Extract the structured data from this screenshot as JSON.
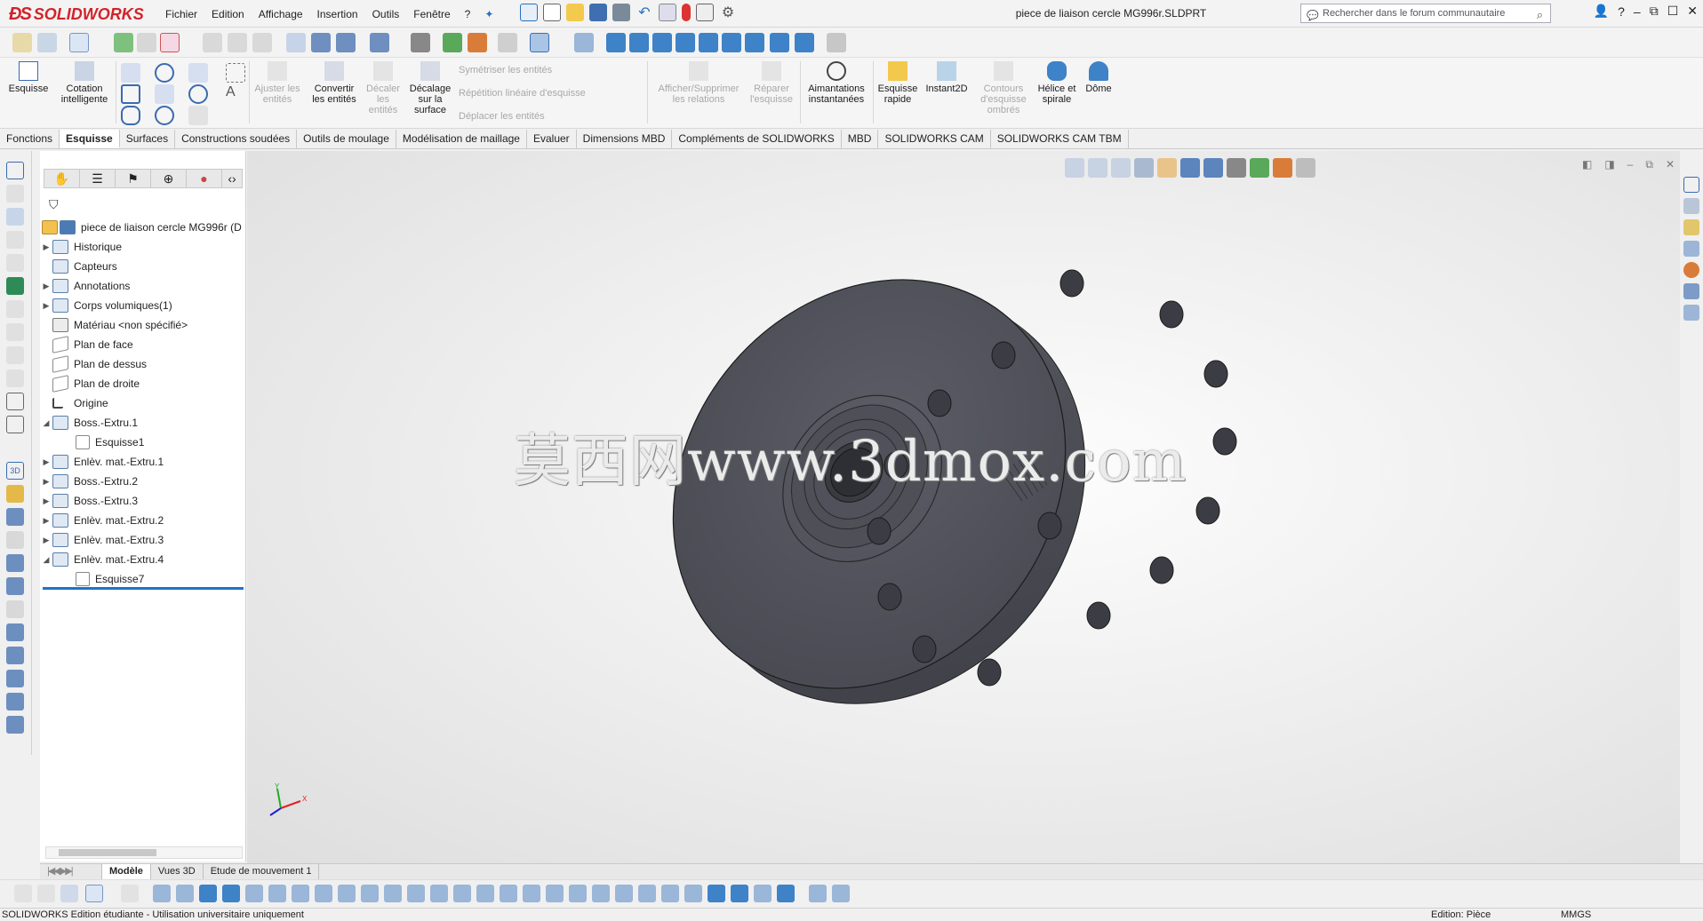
{
  "app": {
    "name": "SOLIDWORKS",
    "title": "piece de liaison cercle MG996r.SLDPRT"
  },
  "menu": [
    "Fichier",
    "Edition",
    "Affichage",
    "Insertion",
    "Outils",
    "Fenêtre",
    "?"
  ],
  "search": {
    "placeholder": "Rechercher dans le forum communautaire"
  },
  "ribbon": {
    "esquisse": "Esquisse",
    "cotation": "Cotation intelligente",
    "ajuster": "Ajuster les entités",
    "convertir": "Convertir les entités",
    "decaler": "Décaler les entités",
    "decalage_surface": "Décalage sur la surface",
    "symetriser": "Symétriser les entités",
    "repetition": "Répétition linéaire d'esquisse",
    "deplacer": "Déplacer les entités",
    "afficher_relations": "Afficher/Supprimer les relations",
    "reparer": "Réparer l'esquisse",
    "aimantations": "Aimantations instantanées",
    "esquisse_rapide": "Esquisse rapide",
    "instant2d": "Instant2D",
    "contours": "Contours d'esquisse ombrés",
    "helice": "Hélice et spirale",
    "dome": "Dôme"
  },
  "tabs": [
    "Fonctions",
    "Esquisse",
    "Surfaces",
    "Constructions soudées",
    "Outils de moulage",
    "Modélisation de maillage",
    "Evaluer",
    "Dimensions MBD",
    "Compléments de SOLIDWORKS",
    "MBD",
    "SOLIDWORKS CAM",
    "SOLIDWORKS CAM TBM"
  ],
  "active_tab": "Esquisse",
  "tree": {
    "root": "piece de liaison cercle MG996r  (D",
    "items": [
      {
        "label": "Historique"
      },
      {
        "label": "Capteurs"
      },
      {
        "label": "Annotations"
      },
      {
        "label": "Corps volumiques(1)"
      },
      {
        "label": "Matériau <non spécifié>"
      },
      {
        "label": "Plan de face"
      },
      {
        "label": "Plan de dessus"
      },
      {
        "label": "Plan de droite"
      },
      {
        "label": "Origine"
      },
      {
        "label": "Boss.-Extru.1"
      },
      {
        "label": "Esquisse1"
      },
      {
        "label": "Enlèv. mat.-Extru.1"
      },
      {
        "label": "Boss.-Extru.2"
      },
      {
        "label": "Boss.-Extru.3"
      },
      {
        "label": "Enlèv. mat.-Extru.2"
      },
      {
        "label": "Enlèv. mat.-Extru.3"
      },
      {
        "label": "Enlèv. mat.-Extru.4"
      },
      {
        "label": "Esquisse7"
      }
    ]
  },
  "watermark": "莫西网www.3dmox.com",
  "bottom_tabs": [
    "Modèle",
    "Vues 3D",
    "Etude de mouvement 1"
  ],
  "status": {
    "left": "SOLIDWORKS Edition étudiante - Utilisation universitaire uniquement",
    "edition": "Edition: Pièce",
    "units": "MMGS"
  },
  "colors": {
    "brand": "#d2232a",
    "part": "#53545c",
    "selection": "#1f73c7"
  }
}
